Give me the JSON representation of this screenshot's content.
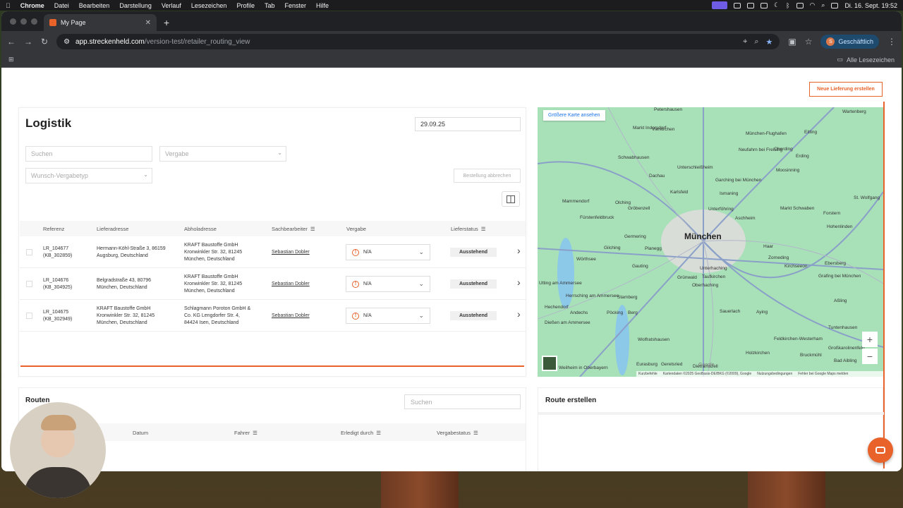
{
  "menubar": {
    "app": "Chrome",
    "items": [
      "Datei",
      "Bearbeiten",
      "Darstellung",
      "Verlauf",
      "Lesezeichen",
      "Profile",
      "Tab",
      "Fenster",
      "Hilfe"
    ],
    "clock": "Di. 16. Sept. 19:52"
  },
  "browser": {
    "tab_title": "My Page",
    "url_host": "app.streckenheld.com",
    "url_path": "/version-test/retailer_routing_view",
    "profile_initial": "S",
    "profile_label": "Geschäftlich",
    "bookmarks_all": "Alle Lesezeichen"
  },
  "header": {
    "new_delivery_label": "Neue Lieferung erstellen"
  },
  "logistik": {
    "title": "Logistik",
    "date": "29.09.25",
    "search_placeholder": "Suchen",
    "vergabe_placeholder": "Vergabe",
    "vergabetyp_placeholder": "Wunsch-Vergabetyp",
    "cancel_order_label": "Bestellung abbrechen",
    "columns": [
      "Referenz",
      "Lieferadresse",
      "Abholadresse",
      "Sachbearbeiter",
      "Vergabe",
      "Lieferstatus"
    ],
    "rows": [
      {
        "ref": "LR_104677",
        "ref_sub": "(KB_302859)",
        "liefer1": "Hermann-Köhl-Straße 3, 86159",
        "liefer2": "Augsburg, Deutschland",
        "liefer3": "",
        "abhol1": "KRAFT Baustoffe GmbH",
        "abhol2": "Kronwinkler Str. 32, 81245",
        "abhol3": "München, Deutschland",
        "sachbearbeiter": "Sebastian Dobler",
        "vergabe": "N/A",
        "status": "Ausstehend"
      },
      {
        "ref": "LR_104676",
        "ref_sub": "(KB_304925)",
        "liefer1": "Belgradstraße 43, 80796",
        "liefer2": "München, Deutschland",
        "liefer3": "",
        "abhol1": "KRAFT Baustoffe GmbH",
        "abhol2": "Kronwinkler Str. 32, 81245",
        "abhol3": "München, Deutschland",
        "sachbearbeiter": "Sebastian Dobler",
        "vergabe": "N/A",
        "status": "Ausstehend"
      },
      {
        "ref": "LR_104675",
        "ref_sub": "(KB_302949)",
        "liefer1": "KRAFT Baustoffe GmbH",
        "liefer2": "Kronwinkler Str. 32, 81245",
        "liefer3": "München, Deutschland",
        "abhol1": "Schlagmann Poroton GmbH &",
        "abhol2": "Co. KG Lengdorfer Str. 4,",
        "abhol3": "84424 Isen, Deutschland",
        "sachbearbeiter": "Sebastian Dobler",
        "vergabe": "N/A",
        "status": "Ausstehend"
      }
    ]
  },
  "map": {
    "enlarge_label": "Größere Karte ansehen",
    "city": "München",
    "labels": [
      "Petershausen",
      "Wartenberg",
      "Markt Indersdorf",
      "Vierkirchen",
      "München-Flughafen",
      "Eitting",
      "Neufahrn bei Freising",
      "Oberding",
      "Schwabhausen",
      "Erding",
      "Dachau",
      "Unterschleißheim",
      "Garching bei München",
      "Moosinning",
      "Karlsfeld",
      "Ismaning",
      "Mammendorf",
      "Olching",
      "Gröbenzell",
      "Unterföhring",
      "Aschheim",
      "Markt Schwaben",
      "Forstern",
      "Fürstenfeldbruck",
      "Gilching",
      "Germering",
      "Planegg",
      "Haar",
      "Hohenlinden",
      "Zorneding",
      "Kirchseeon",
      "Ebersberg",
      "Wörthsee",
      "Gauting",
      "Unterhaching",
      "Grafing bei München",
      "Taufkirchen",
      "Grünwald",
      "Oberhaching",
      "Starnberg",
      "Aßling",
      "Herrsching am Ammersee",
      "Andechs",
      "Pöcking",
      "Berg",
      "Sauerlach",
      "Aying",
      "Dießen am Ammersee",
      "Wolfratshausen",
      "Feldkirchen-Westerham",
      "Tuntenhausen",
      "Geretsried",
      "Holzkirchen",
      "Bruckmühl",
      "Großkarolinenfeld",
      "Eurasburg",
      "Dietramszell",
      "Bad Aibling",
      "Weilheim in Oberbayern",
      "Utting am Ammersee",
      "Hechendorf",
      "St. Wolfgang"
    ],
    "zoom_in": "+",
    "zoom_out": "−",
    "footer": [
      "Kurzbefehle",
      "Kartendaten ©2025 GeoBasis-DE/BKG (©2009), Google",
      "Nutzungsbedingungen",
      "Fehler bei Google Maps melden"
    ],
    "google": "Google"
  },
  "routes": {
    "title": "Routen",
    "search_placeholder": "Suchen",
    "columns": [
      "Datum",
      "Fahrer",
      "Erledigt durch",
      "Vergabestatus"
    ]
  },
  "route_create": {
    "title": "Route erstellen"
  },
  "colors": {
    "accent": "#e8622a",
    "map_green": "#a8e0b8",
    "link_blue": "#1a73e8"
  }
}
